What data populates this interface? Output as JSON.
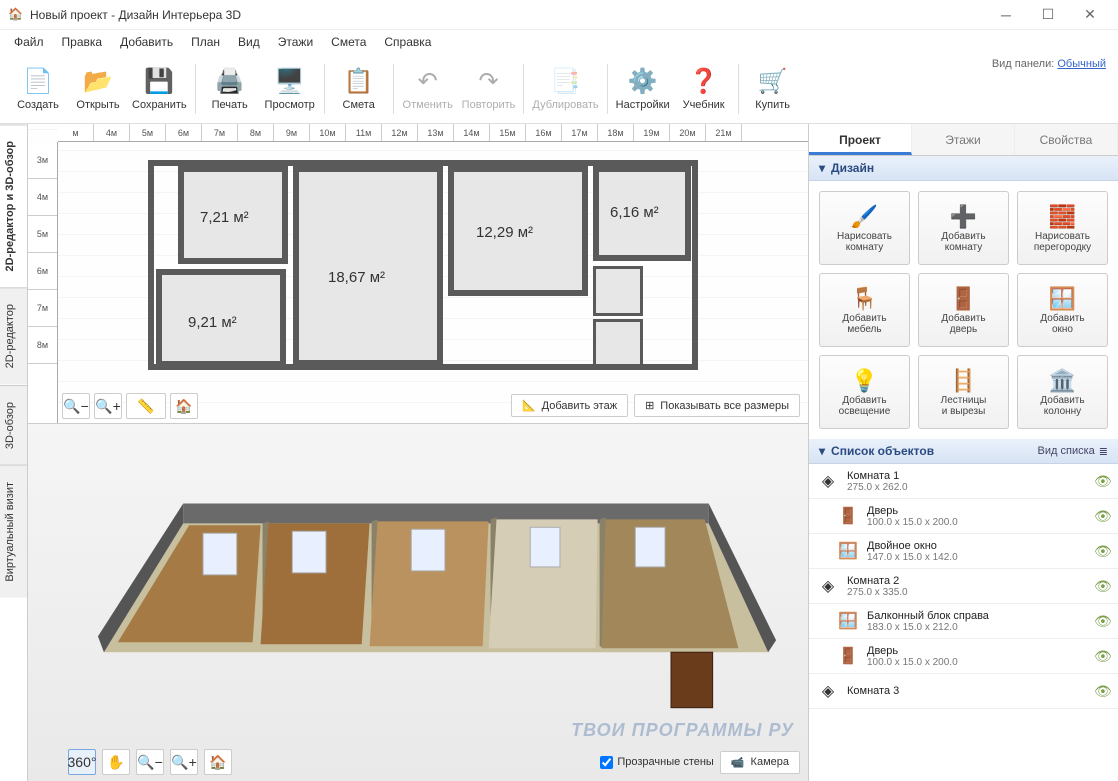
{
  "window": {
    "title": "Новый проект - Дизайн Интерьера 3D"
  },
  "menubar": [
    "Файл",
    "Правка",
    "Добавить",
    "План",
    "Вид",
    "Этажи",
    "Смета",
    "Справка"
  ],
  "toolbar": [
    {
      "label": "Создать",
      "icon": "📄",
      "sep": false
    },
    {
      "label": "Открыть",
      "icon": "📂",
      "sep": false
    },
    {
      "label": "Сохранить",
      "icon": "💾",
      "sep": true
    },
    {
      "label": "Печать",
      "icon": "🖨️",
      "sep": false
    },
    {
      "label": "Просмотр",
      "icon": "🖥️",
      "sep": true
    },
    {
      "label": "Смета",
      "icon": "📋",
      "sep": true
    },
    {
      "label": "Отменить",
      "icon": "↶",
      "sep": false,
      "disabled": true
    },
    {
      "label": "Повторить",
      "icon": "↷",
      "sep": true,
      "disabled": true
    },
    {
      "label": "Дублировать",
      "icon": "📑",
      "sep": true,
      "disabled": true
    },
    {
      "label": "Настройки",
      "icon": "⚙️",
      "sep": false
    },
    {
      "label": "Учебник",
      "icon": "❓",
      "sep": true
    },
    {
      "label": "Купить",
      "icon": "🛒",
      "sep": false
    }
  ],
  "panelmode": {
    "label": "Вид панели:",
    "value": "Обычный"
  },
  "sidetabs": [
    "2D-редактор и 3D-обзор",
    "2D-редактор",
    "3D-обзор",
    "Виртуальный визит"
  ],
  "ruler_h": [
    "м",
    "4м",
    "5м",
    "6м",
    "7м",
    "8м",
    "9м",
    "10м",
    "11м",
    "12м",
    "13м",
    "14м",
    "15м",
    "16м",
    "17м",
    "18м",
    "19м",
    "20м",
    "21м"
  ],
  "ruler_v": [
    "3м",
    "4м",
    "5м",
    "6м",
    "7м",
    "8м"
  ],
  "rooms": {
    "r1": "7,21 м²",
    "r2": "18,67 м²",
    "r3": "12,29 м²",
    "r4": "6,16 м²",
    "r5": "9,21 м²"
  },
  "planbar": {
    "addfloor": "Добавить этаж",
    "showdims": "Показывать все размеры"
  },
  "rtabs": [
    "Проект",
    "Этажи",
    "Свойства"
  ],
  "design_head": "Дизайн",
  "gridtools": [
    {
      "label": "Нарисовать комнату",
      "icon": "🖌️"
    },
    {
      "label": "Добавить комнату",
      "icon": "➕"
    },
    {
      "label": "Нарисовать перегородку",
      "icon": "🧱"
    },
    {
      "label": "Добавить мебель",
      "icon": "🪑"
    },
    {
      "label": "Добавить дверь",
      "icon": "🚪"
    },
    {
      "label": "Добавить окно",
      "icon": "🪟"
    },
    {
      "label": "Добавить освещение",
      "icon": "💡"
    },
    {
      "label": "Лестницы и вырезы",
      "icon": "🪜"
    },
    {
      "label": "Добавить колонну",
      "icon": "🏛️"
    }
  ],
  "objlist_head": "Список объектов",
  "listmode": "Вид списка",
  "objects": [
    {
      "name": "Комната 1",
      "dim": "275.0 x 262.0",
      "icon": "◈",
      "child": false
    },
    {
      "name": "Дверь",
      "dim": "100.0 x 15.0 x 200.0",
      "icon": "🚪",
      "child": true
    },
    {
      "name": "Двойное окно",
      "dim": "147.0 x 15.0 x 142.0",
      "icon": "🪟",
      "child": true
    },
    {
      "name": "Комната 2",
      "dim": "275.0 x 335.0",
      "icon": "◈",
      "child": false
    },
    {
      "name": "Балконный блок справа",
      "dim": "183.0 x 15.0 x 212.0",
      "icon": "🪟",
      "child": true
    },
    {
      "name": "Дверь",
      "dim": "100.0 x 15.0 x 200.0",
      "icon": "🚪",
      "child": true
    },
    {
      "name": "Комната 3",
      "dim": "",
      "icon": "◈",
      "child": false
    }
  ],
  "view3d": {
    "transparent": "Прозрачные стены",
    "camera": "Камера"
  },
  "watermark": "ТВОИ ПРОГРАММЫ РУ"
}
